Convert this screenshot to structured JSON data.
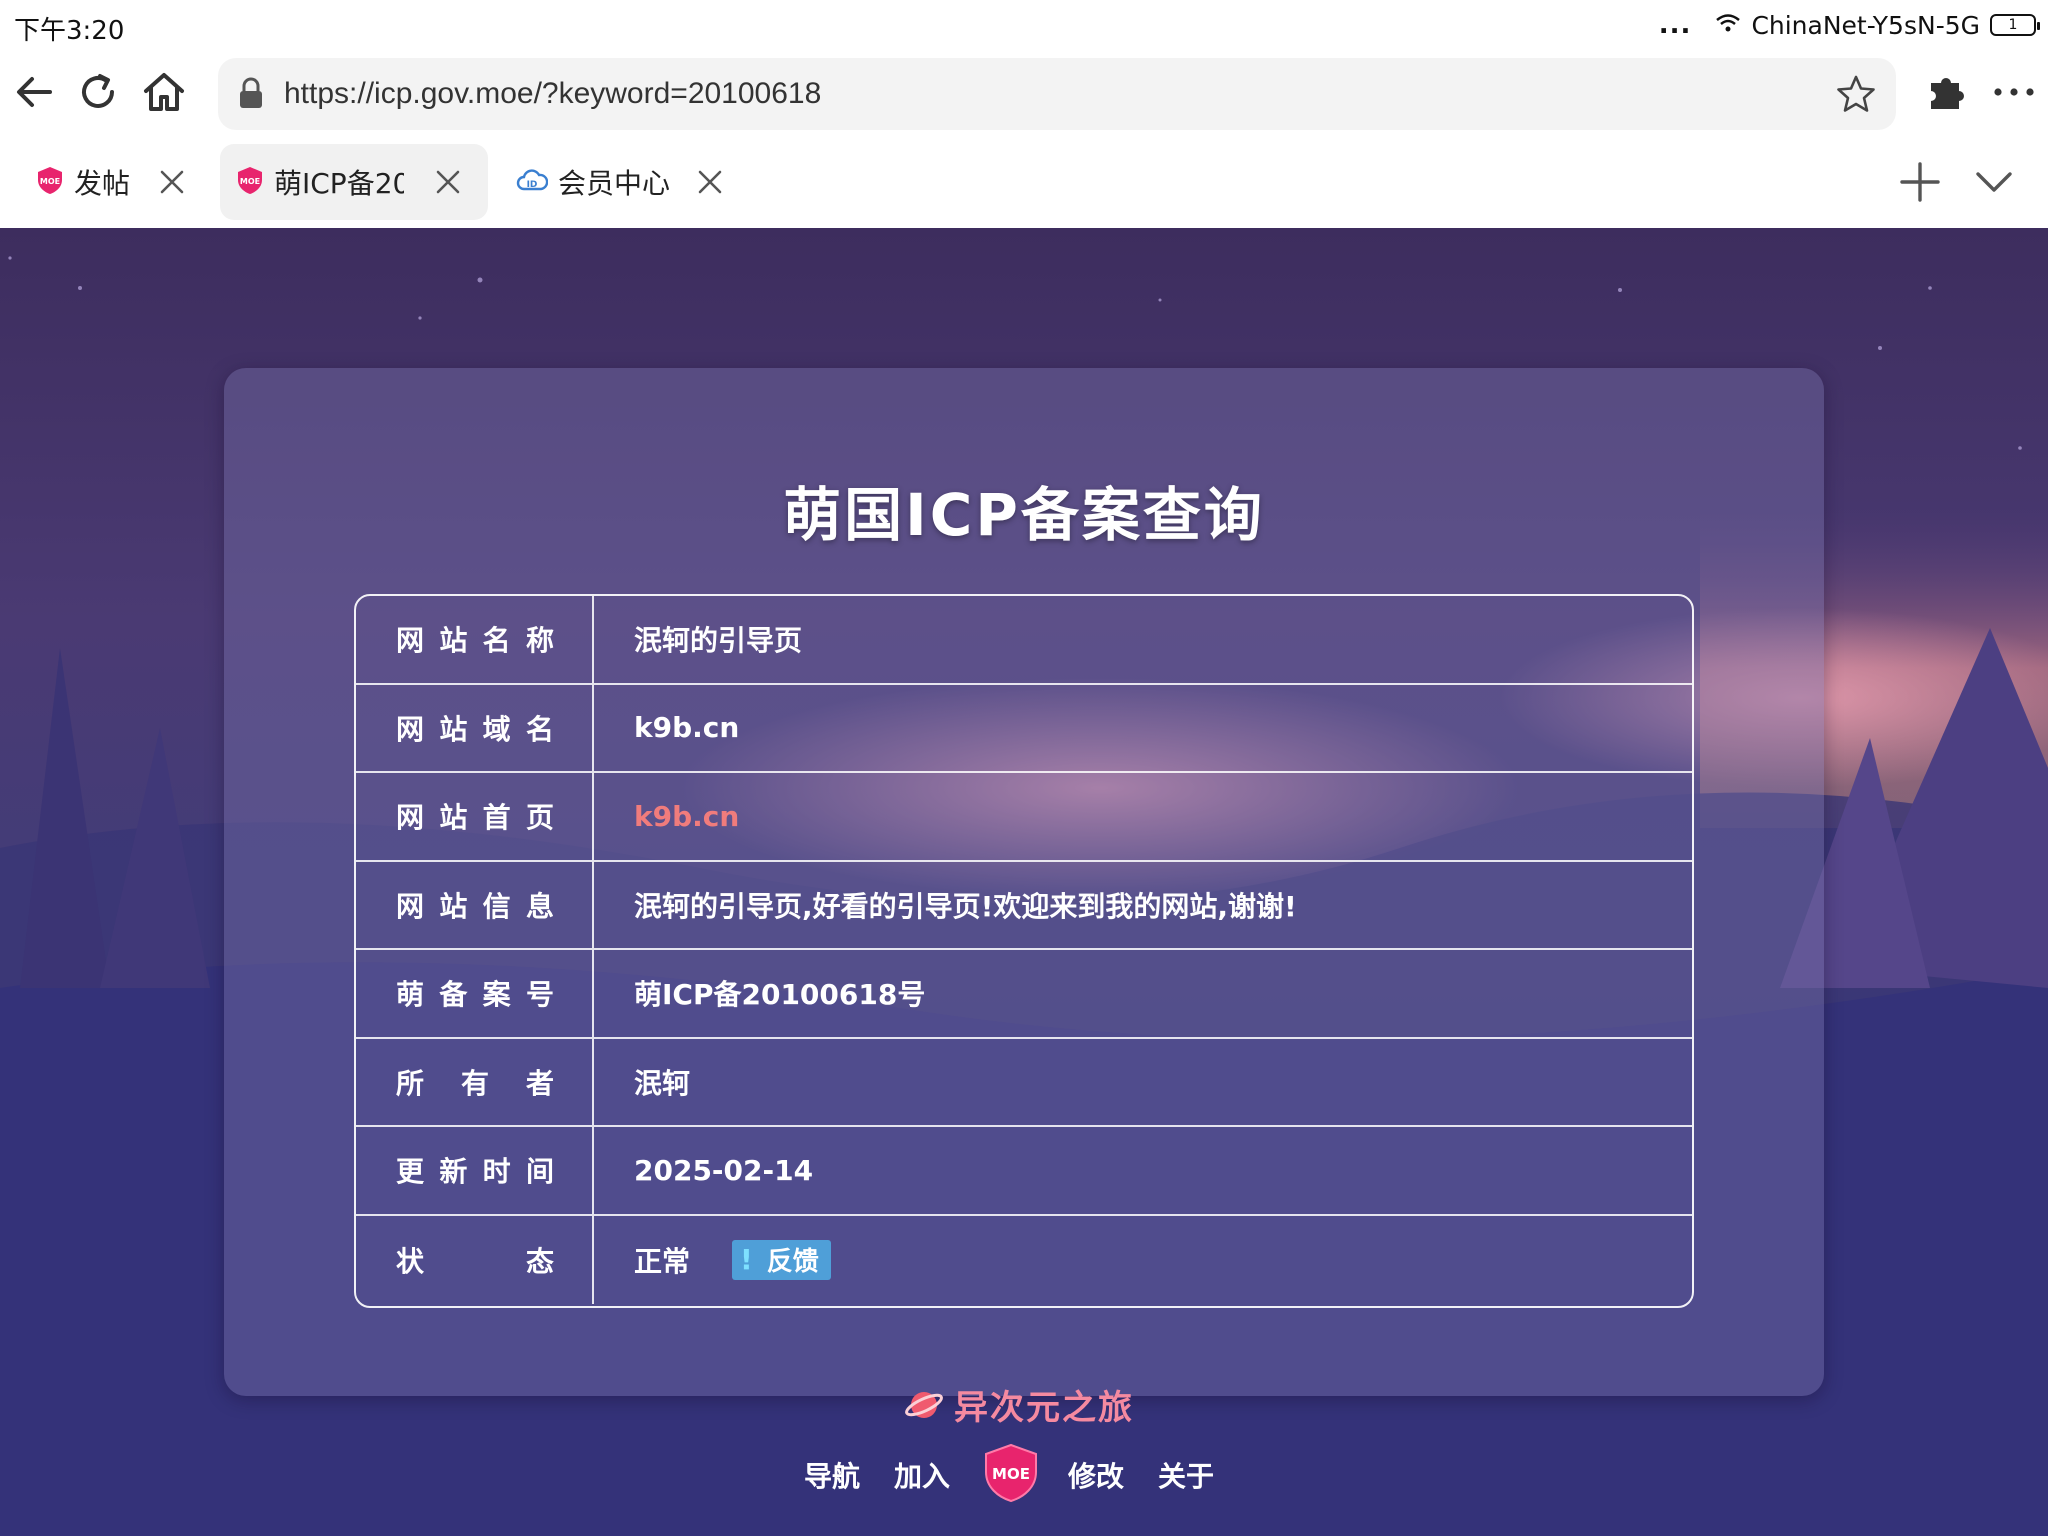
{
  "status_bar": {
    "time": "下午3:20",
    "dots": "...",
    "wifi_name": "ChinaNet-Y5sN-5G",
    "battery": "1"
  },
  "toolbar": {
    "url": "https://icp.gov.moe/?keyword=20100618"
  },
  "tabs": [
    {
      "label": "发帖",
      "icon": "moe-shield-icon",
      "active": false
    },
    {
      "label": "萌ICP备20",
      "icon": "moe-shield-icon",
      "active": true
    },
    {
      "label": "会员中心",
      "icon": "cloud-id-icon",
      "active": false
    }
  ],
  "card": {
    "title": "萌国ICP备案查询",
    "rows": [
      {
        "key": [
          "网",
          "站",
          "名",
          "称"
        ],
        "value": "泯轲的引导页"
      },
      {
        "key": [
          "网",
          "站",
          "域",
          "名"
        ],
        "value": "k9b.cn"
      },
      {
        "key": [
          "网",
          "站",
          "首",
          "页"
        ],
        "value": "k9b.cn"
      },
      {
        "key": [
          "网",
          "站",
          "信",
          "息"
        ],
        "value": "泯轲的引导页,好看的引导页!欢迎来到我的网站,谢谢!"
      },
      {
        "key": [
          "萌",
          "备",
          "案",
          "号"
        ],
        "value": "萌ICP备20100618号"
      },
      {
        "key": [
          "所",
          "有",
          "者"
        ],
        "value": "泯轲"
      },
      {
        "key": [
          "更",
          "新",
          "时",
          "间"
        ],
        "value": "2025-02-14"
      },
      {
        "key": [
          "状",
          "态"
        ],
        "value": "正常"
      }
    ],
    "feedback_mark": "!",
    "feedback_label": "反馈"
  },
  "footer": {
    "brand": "异次元之旅",
    "nav": [
      "导航",
      "加入",
      "修改",
      "关于"
    ],
    "badge_text": "MOE"
  },
  "colors": {
    "accent_pink": "#f58aa0",
    "link_salmon": "#f07c7c",
    "feedback_blue": "#4f9fd8",
    "moe_badge": "#e8246d"
  }
}
